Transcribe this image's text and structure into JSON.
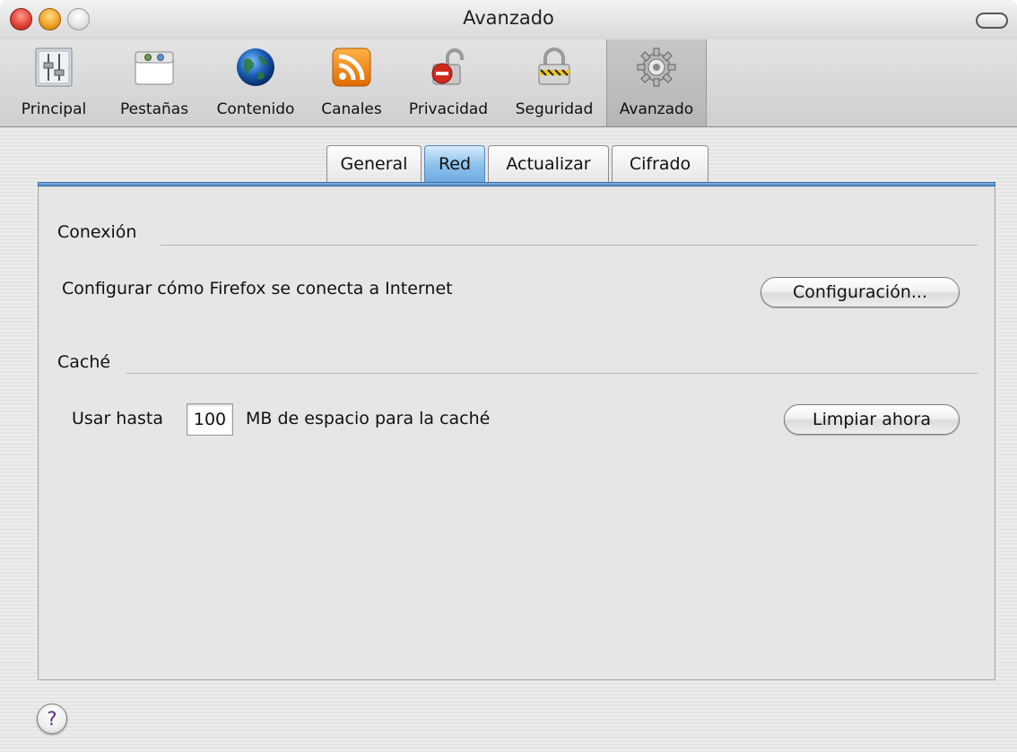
{
  "window": {
    "title": "Avanzado"
  },
  "toolbar": {
    "items": [
      {
        "label": "Principal",
        "icon": "sliders-icon"
      },
      {
        "label": "Pestañas",
        "icon": "tabs-window-icon"
      },
      {
        "label": "Contenido",
        "icon": "globe-icon"
      },
      {
        "label": "Canales",
        "icon": "rss-feed-icon"
      },
      {
        "label": "Privacidad",
        "icon": "unlocked-padlock-icon"
      },
      {
        "label": "Seguridad",
        "icon": "locked-padlock-icon"
      },
      {
        "label": "Avanzado",
        "icon": "gear-icon",
        "selected": true
      }
    ]
  },
  "tabs": {
    "items": [
      {
        "label": "General"
      },
      {
        "label": "Red",
        "active": true
      },
      {
        "label": "Actualizar"
      },
      {
        "label": "Cifrado"
      }
    ]
  },
  "connection": {
    "heading": "Conexión",
    "description": "Configurar cómo Firefox se conecta a Internet",
    "button_label": "Configuración..."
  },
  "cache": {
    "heading": "Caché",
    "prefix": "Usar hasta",
    "value": "100",
    "suffix": "MB de espacio para la caché",
    "button_label": "Limpiar ahora"
  },
  "help": {
    "label": "?"
  },
  "colors": {
    "accent_blue": "#6daae3",
    "close_red": "#e0443a",
    "minimize_orange": "#f0a428"
  }
}
